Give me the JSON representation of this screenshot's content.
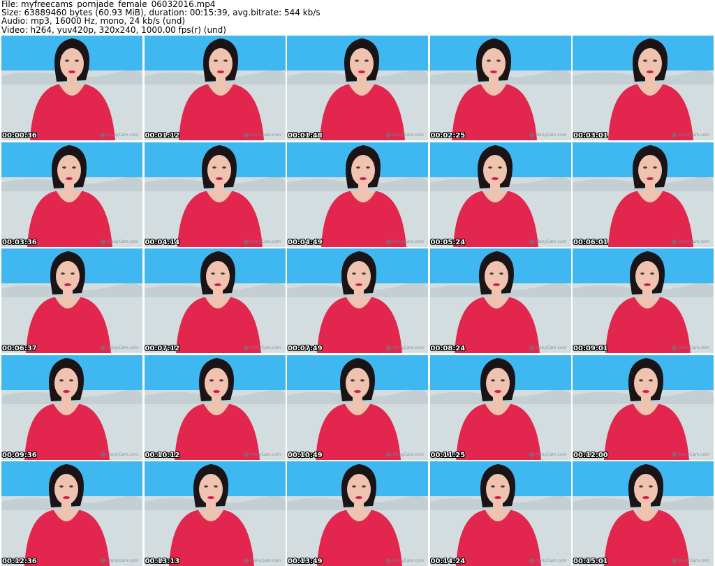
{
  "header": {
    "file_line": "File: myfreecams_pornjade_female_06032016.mp4",
    "size_line": "Size: 63889460 bytes (60.93 MiB), duration: 00:15:39, avg.bitrate: 544 kb/s",
    "audio_line": "Audio: mp3, 16000 Hz, mono, 24 kb/s (und)",
    "video_line": "Video: h264, yuv420p, 320x240, 1000.00 fps(r) (und)"
  },
  "watermark": "ManyCam.com",
  "colors": {
    "wall": "#3fb7f0",
    "couch": "#d3dde0",
    "shirt": "#e3264d",
    "skin": "#f0c3b0",
    "hair": "#1a1416"
  },
  "thumbnails": [
    {
      "timestamp": "00:00:36"
    },
    {
      "timestamp": "00:01:12"
    },
    {
      "timestamp": "00:01:48"
    },
    {
      "timestamp": "00:02:25"
    },
    {
      "timestamp": "00:03:01"
    },
    {
      "timestamp": "00:03:36"
    },
    {
      "timestamp": "00:04:14"
    },
    {
      "timestamp": "00:04:49"
    },
    {
      "timestamp": "00:05:24"
    },
    {
      "timestamp": "00:06:01"
    },
    {
      "timestamp": "00:06:37"
    },
    {
      "timestamp": "00:07:12"
    },
    {
      "timestamp": "00:07:49"
    },
    {
      "timestamp": "00:08:24"
    },
    {
      "timestamp": "00:09:01"
    },
    {
      "timestamp": "00:09:36"
    },
    {
      "timestamp": "00:10:12"
    },
    {
      "timestamp": "00:10:49"
    },
    {
      "timestamp": "00:11:25"
    },
    {
      "timestamp": "00:12:00"
    },
    {
      "timestamp": "00:12:36"
    },
    {
      "timestamp": "00:13:13"
    },
    {
      "timestamp": "00:13:49"
    },
    {
      "timestamp": "00:14:24"
    },
    {
      "timestamp": "00:15:01"
    }
  ]
}
